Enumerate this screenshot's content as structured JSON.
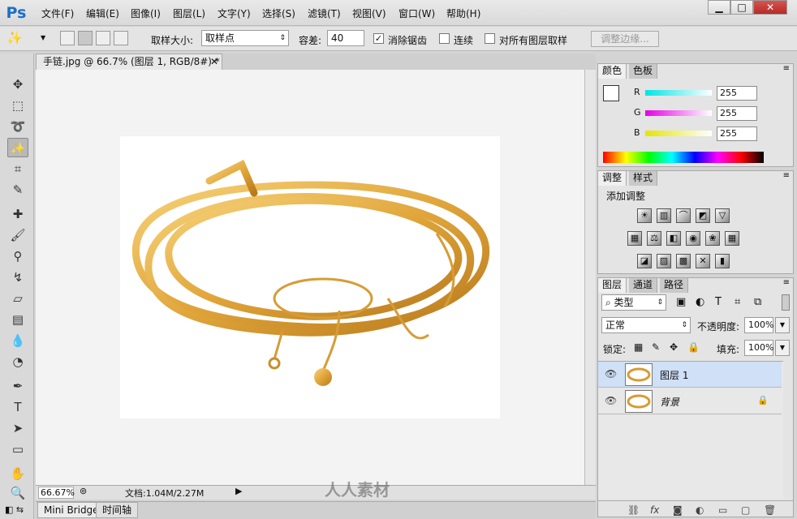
{
  "app": {
    "logo": "Ps"
  },
  "menu": [
    "文件(F)",
    "编辑(E)",
    "图像(I)",
    "图层(L)",
    "文字(Y)",
    "选择(S)",
    "滤镜(T)",
    "视图(V)",
    "窗口(W)",
    "帮助(H)"
  ],
  "window_controls": {
    "minimize": "▁",
    "maximize": "□",
    "close": "✕"
  },
  "options": {
    "sample_size_label": "取样大小:",
    "sample_size_value": "取样点",
    "tolerance_label": "容差:",
    "tolerance_value": "40",
    "antialias_label": "消除锯齿",
    "antialias_checked": true,
    "contiguous_label": "连续",
    "contiguous_checked": false,
    "all_layers_label": "对所有图层取样",
    "all_layers_checked": false,
    "refine_edge_label": "调整边缘..."
  },
  "document": {
    "tab_title": "手链.jpg @ 66.7% (图层 1, RGB/8#) *",
    "zoom": "66.67%",
    "doc_info": "文档:1.04M/2.27M"
  },
  "bottom_tabs": [
    "Mini Bridge",
    "时间轴"
  ],
  "color_panel": {
    "tabs": [
      "颜色",
      "色板"
    ],
    "channels": [
      {
        "label": "R",
        "value": "255",
        "color": "#00e5e5"
      },
      {
        "label": "G",
        "value": "255",
        "color": "#e500e5"
      },
      {
        "label": "B",
        "value": "255",
        "color": "#e5e500"
      }
    ]
  },
  "adjustments_panel": {
    "tabs": [
      "调整",
      "样式"
    ],
    "heading": "添加调整"
  },
  "layers_panel": {
    "tabs": [
      "图层",
      "通道",
      "路径"
    ],
    "filter_label": "类型",
    "blend_mode": "正常",
    "opacity_label": "不透明度:",
    "opacity_value": "100%",
    "lock_label": "锁定:",
    "fill_label": "填充:",
    "fill_value": "100%",
    "layers": [
      {
        "name": "图层 1",
        "selected": true
      },
      {
        "name": "背景",
        "selected": false,
        "locked": true
      }
    ]
  },
  "watermark": "人人素材"
}
